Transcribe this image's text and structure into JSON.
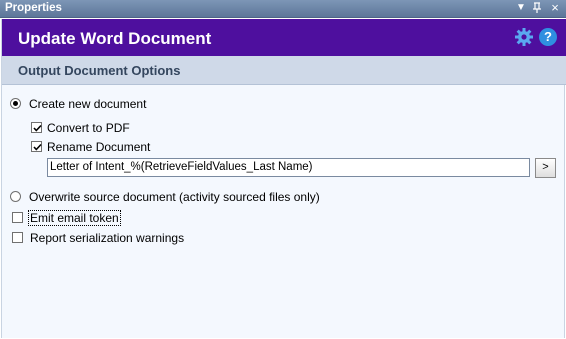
{
  "window": {
    "title": "Properties",
    "buttons": {
      "dropdown": "▼",
      "pin": "ᵖ",
      "close": "×"
    }
  },
  "header": {
    "title": "Update Word Document",
    "icons": [
      "gear-icon",
      "help-icon"
    ],
    "help_glyph": "?",
    "accent_color": "#4e0f9e"
  },
  "section": {
    "title": "Output Document Options"
  },
  "options": {
    "create_new": {
      "label": "Create new document",
      "selected": true
    },
    "convert_pdf": {
      "label": "Convert to PDF",
      "checked": true
    },
    "rename": {
      "label": "Rename Document",
      "checked": true
    },
    "rename_value": "Letter of Intent_%(RetrieveFieldValues_Last Name)",
    "browse_label": ">",
    "overwrite": {
      "label": "Overwrite source document (activity sourced files only)",
      "selected": false
    },
    "emit_email": {
      "label": "Emit email token",
      "checked": false
    },
    "report_warnings": {
      "label": "Report serialization warnings",
      "checked": false
    }
  }
}
